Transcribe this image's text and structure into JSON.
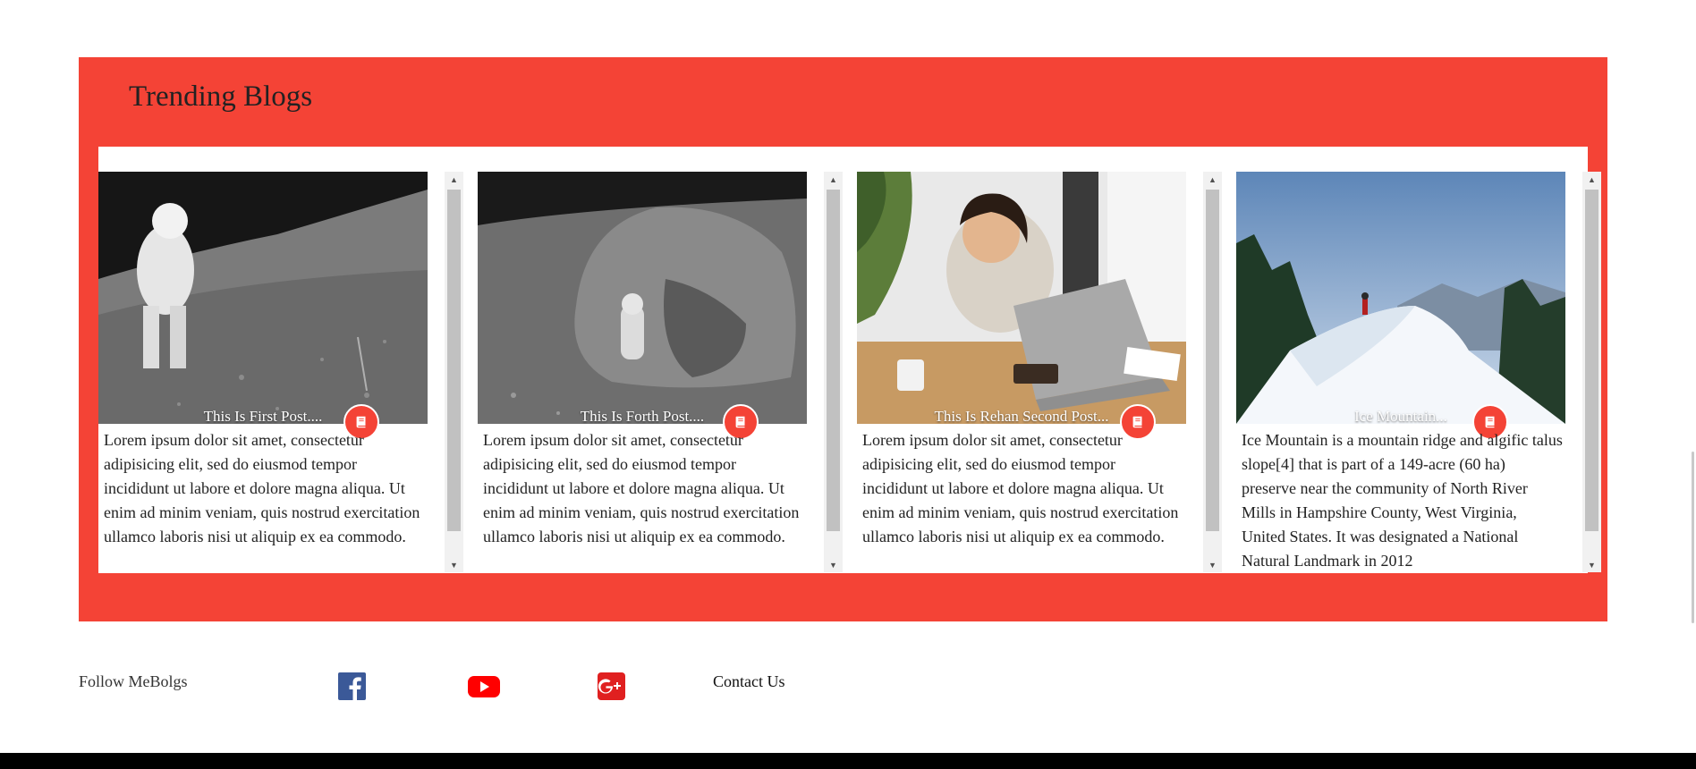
{
  "section": {
    "title": "Trending Blogs"
  },
  "accent_color": "#f44336",
  "cards": [
    {
      "title": "This Is First Post....",
      "text": "Lorem ipsum dolor sit amet, consectetur adipisicing elit, sed do eiusmod tempor incididunt ut labore et dolore magna aliqua. Ut enim ad minim veniam, quis nostrud exercitation ullamco laboris nisi ut aliquip ex ea commodo.",
      "icon": "book-icon"
    },
    {
      "title": "This Is Forth Post....",
      "text": "Lorem ipsum dolor sit amet, consectetur adipisicing elit, sed do eiusmod tempor incididunt ut labore et dolore magna aliqua. Ut enim ad minim veniam, quis nostrud exercitation ullamco laboris nisi ut aliquip ex ea commodo.",
      "icon": "book-icon"
    },
    {
      "title": "This Is Rehan Second Post...",
      "text": "Lorem ipsum dolor sit amet, consectetur adipisicing elit, sed do eiusmod tempor incididunt ut labore et dolore magna aliqua. Ut enim ad minim veniam, quis nostrud exercitation ullamco laboris nisi ut aliquip ex ea commodo.",
      "icon": "book-icon"
    },
    {
      "title": "Ice Mountain...",
      "text": "Ice Mountain is a mountain ridge and algific talus slope[4] that is part of a 149-acre (60 ha) preserve near the community of North River Mills in Hampshire County, West Virginia, United States. It was designated a National Natural Landmark in 2012",
      "icon": "book-icon"
    }
  ],
  "footer": {
    "follow_label": "Follow MeBolgs",
    "social": [
      "facebook-icon",
      "youtube-icon",
      "google-plus-icon"
    ],
    "contact_label": "Contact Us"
  }
}
